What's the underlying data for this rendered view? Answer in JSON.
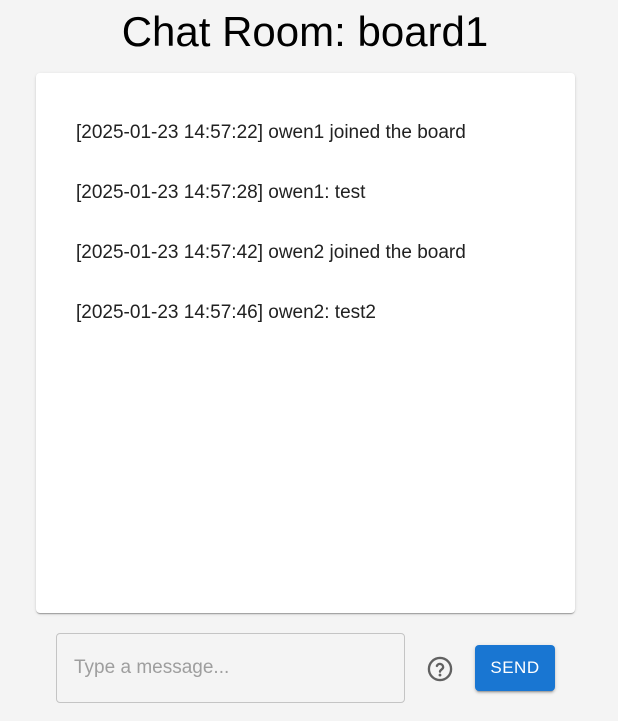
{
  "page": {
    "title": "Chat Room: board1"
  },
  "chat": {
    "messages": [
      {
        "text": "[2025-01-23 14:57:22] owen1 joined the board"
      },
      {
        "text": "[2025-01-23 14:57:28] owen1: test"
      },
      {
        "text": "[2025-01-23 14:57:42] owen2 joined the board"
      },
      {
        "text": "[2025-01-23 14:57:46] owen2: test2"
      }
    ]
  },
  "composer": {
    "placeholder": "Type a message...",
    "value": "",
    "help_icon": "help-circle-outline-icon",
    "send_label": "SEND"
  },
  "colors": {
    "accent": "#1976d2",
    "background": "#f4f4f4",
    "panel": "#ffffff",
    "help_icon": "#616161"
  }
}
